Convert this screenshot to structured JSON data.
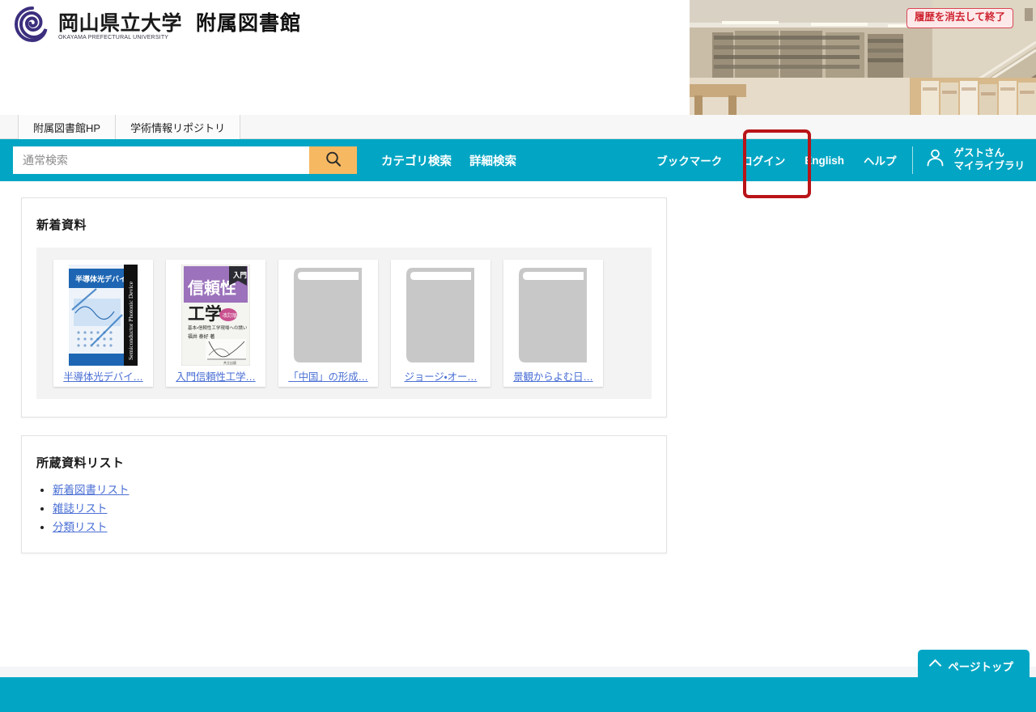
{
  "header": {
    "university_name": "岡山県立大学",
    "university_name_en": "OKAYAMA PREFECTURAL UNIVERSITY",
    "library_name": "附属図書館",
    "logo_icon": "spiral-logo-icon",
    "photo_alt": "library-interior-photo",
    "exit_button": "履歴を消去して終了"
  },
  "tabs": [
    {
      "label": "附属図書館HP"
    },
    {
      "label": "学術情報リポジトリ"
    }
  ],
  "search": {
    "placeholder": "通常検索",
    "value": "",
    "search_icon": "search-icon",
    "links": [
      {
        "label": "カテゴリ検索"
      },
      {
        "label": "詳細検索"
      }
    ]
  },
  "utility": {
    "links": [
      {
        "label": "ブックマーク"
      },
      {
        "label": "ログイン"
      },
      {
        "label": "English"
      },
      {
        "label": "ヘルプ"
      }
    ],
    "mylibrary": {
      "icon": "user-icon",
      "user_label": "ゲストさん",
      "link_label": "マイライブラリ"
    }
  },
  "highlight": {
    "target": "ログイン",
    "color": "#b91418"
  },
  "new_arrivals": {
    "title": "新着資料",
    "books": [
      {
        "title": "半導体光デバイ…",
        "cover": "semiconductor-photonic-devices-cover"
      },
      {
        "title": "入門信頼性工学…",
        "cover": "reliability-engineering-cover"
      },
      {
        "title": "「中国」の形成…",
        "cover": "placeholder-book-icon"
      },
      {
        "title": "ジョージ・オー…",
        "cover": "placeholder-book-icon"
      },
      {
        "title": "景観からよむ日…",
        "cover": "placeholder-book-icon"
      }
    ]
  },
  "holdings": {
    "title": "所蔵資料リスト",
    "links": [
      {
        "label": "新着図書リスト"
      },
      {
        "label": "雑誌リスト"
      },
      {
        "label": "分類リスト"
      }
    ]
  },
  "pagetop": {
    "label": "ページトップ",
    "icon": "chevron-up-icon"
  },
  "colors": {
    "teal": "#02a6c4",
    "orange": "#f6b861",
    "link_blue": "#4a6fd4",
    "highlight_red": "#b91418",
    "exit_red": "#cf2331"
  }
}
